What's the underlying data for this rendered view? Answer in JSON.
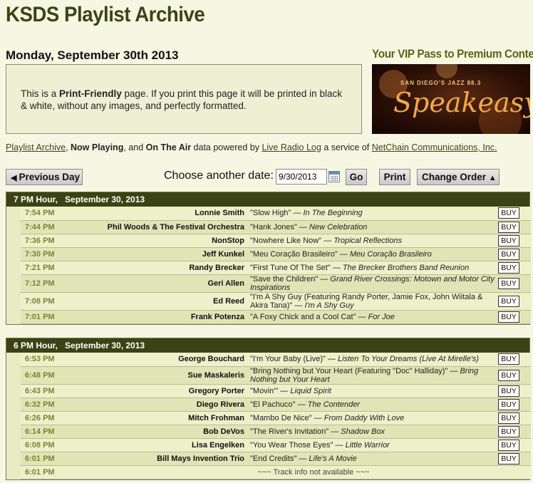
{
  "site_title": "KSDS Playlist Archive",
  "date_heading": "Monday, September 30th 2013",
  "print_notice": {
    "pre": "This is a ",
    "bold": "Print-Friendly",
    "post": " page. If you print this page it will be printed in black & white, without any images, and perfectly formatted."
  },
  "promo": {
    "title": "Your VIP Pass to Premium Content",
    "banner_tagline": "SAN DIEGO'S JAZZ 88.3",
    "banner_brand": "Speakeasy"
  },
  "credits": {
    "link1": "Playlist Archive",
    "sep1": ", ",
    "bold1": "Now Playing",
    "sep2": ", and ",
    "bold2": "On The Air",
    "mid": " data powered by ",
    "link2": "Live Radio Log",
    "mid2": " a service of ",
    "link3": "NetChain Communications, Inc."
  },
  "toolbar": {
    "prev_label": "Previous Day",
    "choose_label": "Choose another date:",
    "date_value": "9/30/2013",
    "go_label": "Go",
    "print_label": "Print",
    "order_label": "Change Order"
  },
  "hours": [
    {
      "header_hour": "7 PM Hour,",
      "header_date": "September 30, 2013",
      "tracks": [
        {
          "time": "7:54 PM",
          "artist": "Lonnie Smith",
          "song": "\"Slow High\"",
          "album": "In The Beginning",
          "buy": "BUY"
        },
        {
          "time": "7:44 PM",
          "artist": "Phil Woods & The Festival Orchestra",
          "song": "\"Hank Jones\"",
          "album": "New Celebration",
          "buy": "BUY"
        },
        {
          "time": "7:36 PM",
          "artist": "NonStop",
          "song": "\"Nowhere Like Now\"",
          "album": "Tropical Reflections",
          "buy": "BUY"
        },
        {
          "time": "7:30 PM",
          "artist": "Jeff Kunkel",
          "song": "\"Meu Coração Brasileiro\"",
          "album": "Meu Coração Brasileiro",
          "buy": "BUY"
        },
        {
          "time": "7:21 PM",
          "artist": "Randy Brecker",
          "song": "\"First Tune Of The Set\"",
          "album": "The Brecker Brothers Band Reunion",
          "buy": "BUY"
        },
        {
          "time": "7:12 PM",
          "artist": "Geri Allen",
          "song": "\"Save the Children\"",
          "album": "Grand River Crossings: Motown and Motor City Inspirations",
          "buy": "BUY"
        },
        {
          "time": "7:08 PM",
          "artist": "Ed Reed",
          "song": "\"I'm A Shy Guy (Featuring Randy Porter, Jamie Fox, John Wiitala & Akira Tana)\"",
          "album": "I'm A Shy Guy",
          "buy": "BUY"
        },
        {
          "time": "7:01 PM",
          "artist": "Frank Potenza",
          "song": "\"A Foxy Chick and a Cool Cat\"",
          "album": "For Joe",
          "buy": "BUY"
        }
      ]
    },
    {
      "header_hour": "6 PM Hour,",
      "header_date": "September 30, 2013",
      "tracks": [
        {
          "time": "6:53 PM",
          "artist": "George Bouchard",
          "song": "\"I'm Your Baby (Live)\"",
          "album": "Listen To Your Dreams (Live At Mirelle's)",
          "buy": "BUY"
        },
        {
          "time": "6:48 PM",
          "artist": "Sue Maskaleris",
          "song": "\"Bring Nothing but Your Heart (Featuring \"Doc\" Halliday)\"",
          "album": "Bring Nothing but Your Heart",
          "buy": "BUY"
        },
        {
          "time": "6:43 PM",
          "artist": "Gregory Porter",
          "song": "\"Movin'\"",
          "album": "Liquid Spirit",
          "buy": "BUY"
        },
        {
          "time": "6:32 PM",
          "artist": "Diego Rivera",
          "song": "\"El Pachuco\"",
          "album": "The Contender",
          "buy": "BUY"
        },
        {
          "time": "6:26 PM",
          "artist": "Mitch Frohman",
          "song": "\"Mambo De Nice\"",
          "album": "From Daddy With Love",
          "buy": "BUY"
        },
        {
          "time": "6:14 PM",
          "artist": "Bob DeVos",
          "song": "\"The River's Invitation\"",
          "album": "Shadow Box",
          "buy": "BUY"
        },
        {
          "time": "6:08 PM",
          "artist": "Lisa Engelken",
          "song": "\"You Wear Those Eyes\"",
          "album": "Little Warrior",
          "buy": "BUY"
        },
        {
          "time": "6:01 PM",
          "artist": "Bill Mays Invention Trio",
          "song": "\"End Credits\"",
          "album": "Life's A Movie",
          "buy": "BUY"
        }
      ],
      "na_row": {
        "time": "6:01 PM",
        "text": "~~~ Track info not available ~~~"
      }
    }
  ]
}
